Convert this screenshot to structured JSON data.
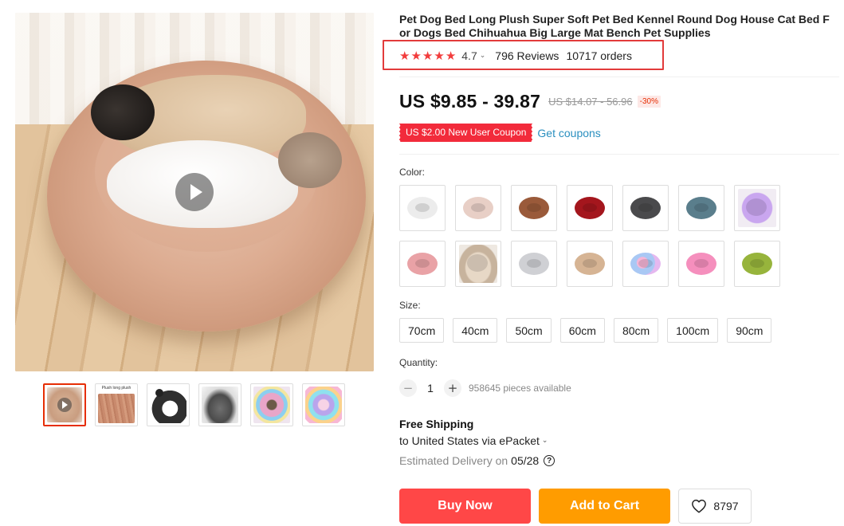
{
  "product": {
    "title": "Pet Dog Bed Long Plush Super Soft Pet Bed Kennel Round Dog House Cat Bed For Dogs Bed Chihuahua Big Large Mat Bench Pet Supplies",
    "rating": {
      "stars": 5,
      "value": "4.7",
      "reviews": "796 Reviews",
      "orders": "10717 orders"
    },
    "price": {
      "current": "US $9.85 - 39.87",
      "original": "US $14.07 - 56.96",
      "discount": "-30%"
    },
    "coupon": {
      "badge": "US $2.00 New User Coupon",
      "link": "Get coupons"
    },
    "accent_color": "#e62e04"
  },
  "gallery": {
    "main_image": "video-preview-pug-and-cat-on-plush-bed",
    "play_icon": "play-icon",
    "thumbnails": [
      {
        "name": "thumb-video",
        "active": true
      },
      {
        "name": "thumb-long-plush",
        "caption": "Plush long plush"
      },
      {
        "name": "thumb-bed-size"
      },
      {
        "name": "thumb-gray-bed"
      },
      {
        "name": "thumb-rainbow-bed"
      },
      {
        "name": "thumb-rainbow-bed-2"
      }
    ]
  },
  "options": {
    "color_label": "Color:",
    "colors": [
      {
        "name": "white",
        "hex": "#ececec"
      },
      {
        "name": "light-pink",
        "hex": "#e8cfc6"
      },
      {
        "name": "brown",
        "hex": "#9a5a3a"
      },
      {
        "name": "wine-red",
        "hex": "#a4161d"
      },
      {
        "name": "dark-gray",
        "hex": "#4a4a4c"
      },
      {
        "name": "blue-gray",
        "hex": "#5a7e8c"
      },
      {
        "name": "purple",
        "hex": "#b68de2",
        "photo": true
      },
      {
        "name": "pink",
        "hex": "#e9a2a6"
      },
      {
        "name": "beige-photo",
        "hex": "#d8c6b2",
        "photo": true
      },
      {
        "name": "light-gray",
        "hex": "#cfd0d4"
      },
      {
        "name": "khaki",
        "hex": "#d6b494"
      },
      {
        "name": "rainbow",
        "hex": "#a7c7f0"
      },
      {
        "name": "rose-pink",
        "hex": "#f58fbd"
      },
      {
        "name": "green",
        "hex": "#97b43c"
      }
    ],
    "size_label": "Size:",
    "sizes": [
      "70cm",
      "40cm",
      "50cm",
      "60cm",
      "80cm",
      "100cm",
      "90cm"
    ],
    "quantity_label": "Quantity:",
    "quantity": {
      "minus": "−",
      "value": "1",
      "plus": "+",
      "available": "958645 pieces available"
    }
  },
  "shipping": {
    "title": "Free Shipping",
    "to": "to United States via ePacket",
    "delivery_prefix": "Estimated Delivery on",
    "delivery_date": "05/28",
    "help_icon": "?"
  },
  "actions": {
    "buy_now": "Buy Now",
    "add_to_cart": "Add to Cart",
    "wishlist_count": "8797"
  }
}
